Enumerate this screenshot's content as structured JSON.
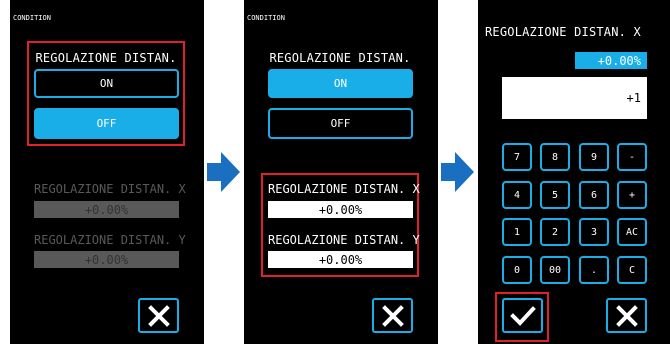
{
  "colors": {
    "accent": "#19aee8",
    "highlight": "#e0202a",
    "dim": "#595959",
    "arrow": "#1a6fc0"
  },
  "screen1": {
    "cond_label": "CONDITION",
    "heading": "REGOLAZIONE DISTAN.",
    "on_label": "ON",
    "off_label": "OFF",
    "x_label": "REGOLAZIONE DISTAN. X",
    "x_value": "+0.00%",
    "y_label": "REGOLAZIONE DISTAN. Y",
    "y_value": "+0.00%",
    "close_icon": "close-icon"
  },
  "screen2": {
    "cond_label": "CONDITION",
    "heading": "REGOLAZIONE DISTAN.",
    "on_label": "ON",
    "off_label": "OFF",
    "x_label": "REGOLAZIONE DISTAN. X",
    "x_value": "+0.00%",
    "y_label": "REGOLAZIONE DISTAN. Y",
    "y_value": "+0.00%",
    "close_icon": "close-icon"
  },
  "screen3": {
    "heading": "REGOLAZIONE DISTAN. X",
    "current_value": "+0.00%",
    "input_value": "+1",
    "keys": {
      "k7": "7",
      "k8": "8",
      "k9": "9",
      "kminus": "-",
      "k4": "4",
      "k5": "5",
      "k6": "6",
      "kplus": "+",
      "k1": "1",
      "k2": "2",
      "k3": "3",
      "kac": "AC",
      "k0": "0",
      "k00": "00",
      "kdot": ".",
      "kc": "C"
    },
    "confirm_icon": "checkmark-icon",
    "close_icon": "close-icon"
  }
}
